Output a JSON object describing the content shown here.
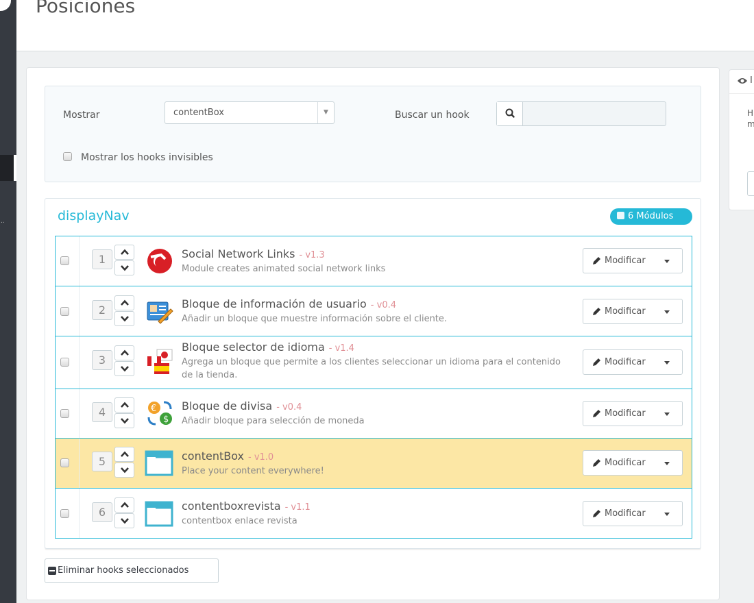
{
  "page": {
    "title": "Posiciones"
  },
  "filters": {
    "show_label": "Mostrar",
    "show_selected": "contentBox",
    "search_label": "Buscar un hook",
    "search_value": "",
    "invisible_label": "Mostrar los hooks invisibles"
  },
  "hook": {
    "name": "displayNav",
    "count_label": "6 Módulos",
    "modules": [
      {
        "position": "1",
        "title": "Social Network Links",
        "version": "- v1.3",
        "description": "Module creates animated social network links",
        "icon": "social-network-icon",
        "modify_label": "Modificar"
      },
      {
        "position": "2",
        "title": "Bloque de información de usuario",
        "version": "- v0.4",
        "description": "Añadir un bloque que muestre información sobre el cliente.",
        "icon": "user-info-icon",
        "modify_label": "Modificar"
      },
      {
        "position": "3",
        "title": "Bloque selector de idioma",
        "version": "- v1.4",
        "description": "Agrega un bloque que permite a los clientes seleccionar un idioma para el contenido de la tienda.",
        "icon": "language-flags-icon",
        "modify_label": "Modificar"
      },
      {
        "position": "4",
        "title": "Bloque de divisa",
        "version": "- v0.4",
        "description": "Añadir bloque para selección de moneda",
        "icon": "currency-icon",
        "modify_label": "Modificar"
      },
      {
        "position": "5",
        "title": "contentBox",
        "version": "- v1.0",
        "description": "Place your content everywhere!",
        "icon": "content-box-icon",
        "modify_label": "Modificar",
        "highlighted": true
      },
      {
        "position": "6",
        "title": "contentboxrevista",
        "version": "- v1.1",
        "description": "contentbox enlace revista",
        "icon": "content-box-icon",
        "modify_label": "Modificar"
      }
    ]
  },
  "actions": {
    "delete_label": "Eliminar hooks seleccionados"
  },
  "side_panel": {
    "header_partial": "I",
    "text_partial": "H fr m d"
  },
  "colors": {
    "accent": "#25b9d7",
    "highlight_row": "#fce7a5",
    "version": "#e08f95",
    "sidebar": "#363a41"
  }
}
